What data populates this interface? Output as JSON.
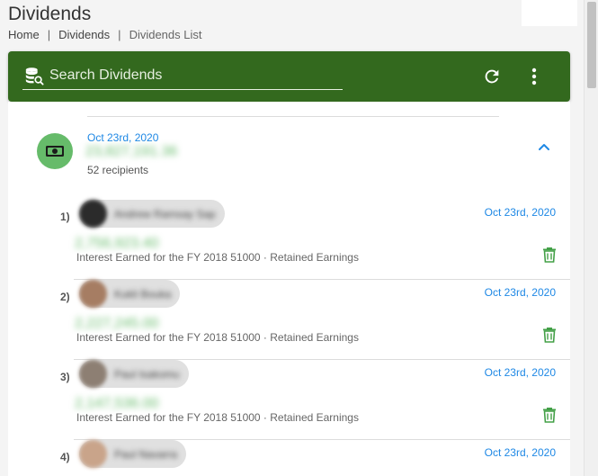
{
  "page": {
    "title": "Dividends",
    "breadcrumb": [
      "Home",
      "Dividends",
      "Dividends List"
    ],
    "breadcrumb_separator": "|"
  },
  "toolbar": {
    "search_placeholder": "Search Dividends",
    "search_icon": "database-search-icon",
    "refresh_icon": "refresh-icon",
    "menu_icon": "more-vertical-icon",
    "background_color": "#33691e"
  },
  "group": {
    "date": "Oct 23rd, 2020",
    "amount": "23,827,191.36",
    "recipients": "52 recipients",
    "icon": "money-icon",
    "accent_color": "#66bb6a"
  },
  "recipients": [
    {
      "index": "1)",
      "name": "Andrew Ramsay Sap",
      "date": "Oct 23rd, 2020",
      "amount": "2,756,923.40",
      "description": "Interest Earned for the FY 2018 51000 · Retained Earnings",
      "avatar_color": "#2b2b2b"
    },
    {
      "index": "2)",
      "name": "Kukli Bouka",
      "date": "Oct 23rd, 2020",
      "amount": "2,227,245.00",
      "description": "Interest Earned for the FY 2018 51000 · Retained Earnings",
      "avatar_color": "#a67d63"
    },
    {
      "index": "3)",
      "name": "Paul Isakomu",
      "date": "Oct 23rd, 2020",
      "amount": "2,147,536.00",
      "description": "Interest Earned for the FY 2018 51000 · Retained Earnings",
      "avatar_color": "#8d7f73"
    },
    {
      "index": "4)",
      "name": "Paul Navarra",
      "date": "Oct 23rd, 2020",
      "amount": "",
      "description": "",
      "avatar_color": "#c9a48a"
    }
  ],
  "colors": {
    "link_blue": "#1e88e5",
    "amount_green": "#66bb6a",
    "trash_green": "#43a047"
  }
}
